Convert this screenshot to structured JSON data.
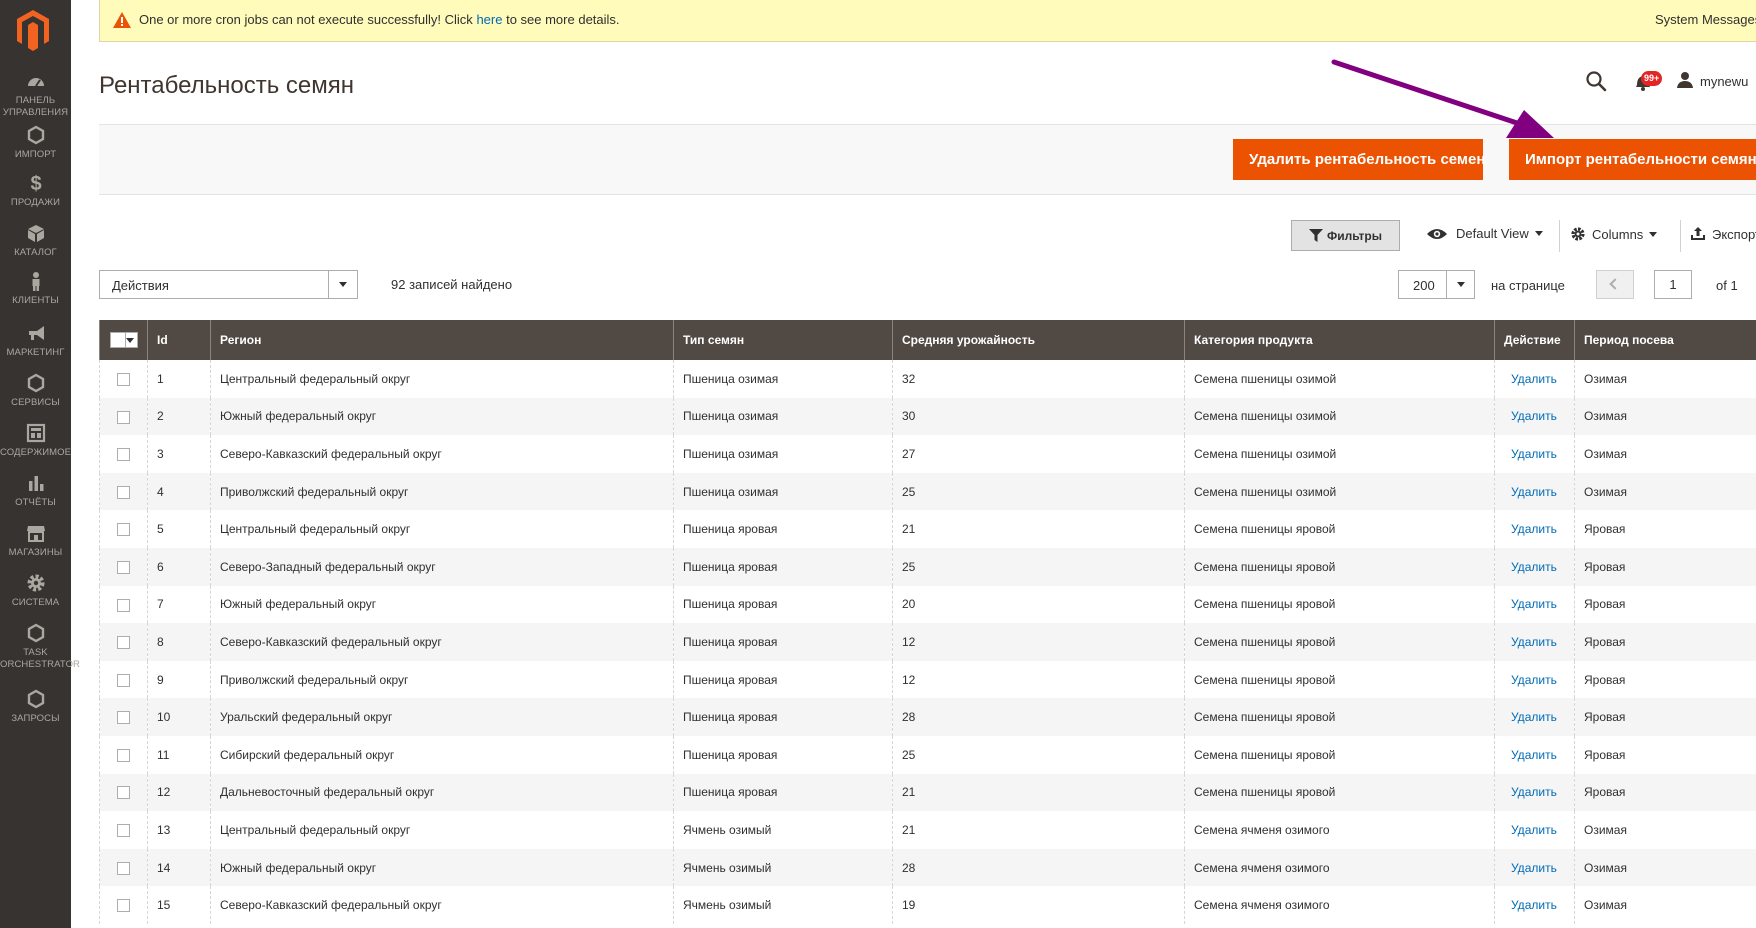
{
  "notice": {
    "text_before": "One or more cron jobs can not execute successfully! Click ",
    "link": "here",
    "text_after": " to see more details.",
    "system_messages": "System Messages"
  },
  "nav": [
    {
      "label": "ПАНЕЛЬ УПРАВЛЕНИЯ",
      "icon": "dashboard-icon"
    },
    {
      "label": "ИМПОРТ",
      "icon": "hexagon-icon"
    },
    {
      "label": "ПРОДАЖИ",
      "icon": "dollar-icon"
    },
    {
      "label": "КАТАЛОГ",
      "icon": "cube-icon"
    },
    {
      "label": "КЛИЕНТЫ",
      "icon": "person-icon"
    },
    {
      "label": "МАРКЕТИНГ",
      "icon": "megaphone-icon"
    },
    {
      "label": "СЕРВИСЫ",
      "icon": "hexagon-icon"
    },
    {
      "label": "СОДЕРЖИМОЕ",
      "icon": "layout-icon"
    },
    {
      "label": "ОТЧЁТЫ",
      "icon": "bar-chart-icon"
    },
    {
      "label": "МАГАЗИНЫ",
      "icon": "store-icon"
    },
    {
      "label": "СИСТЕМА",
      "icon": "gear-icon"
    },
    {
      "label": "TASK ORCHESTRATOR",
      "icon": "hexagon-icon"
    },
    {
      "label": "ЗАПРОСЫ",
      "icon": "hexagon-icon"
    }
  ],
  "header": {
    "title": "Рентабельность семян",
    "notifications_count": "99+",
    "username": "mynewu"
  },
  "buttons": {
    "delete": "Удалить рентабельность семен",
    "import": "Импорт рентабельности семян"
  },
  "toolbar": {
    "filters": "Фильтры",
    "view": "Default View",
    "columns": "Columns",
    "export": "Экспорт"
  },
  "mass_actions": {
    "label": "Действия",
    "records_found": "92 записей найдено"
  },
  "pager": {
    "per_page": "200",
    "per_page_label": "на странице",
    "current_page": "1",
    "of_pages": "of 1"
  },
  "columns": [
    "Id",
    "Регион",
    "Тип семян",
    "Средняя урожайность",
    "Категория продукта",
    "Действие",
    "Период посева"
  ],
  "rows": [
    {
      "id": "1",
      "region": "Центральный федеральный округ",
      "type": "Пшеница озимая",
      "yield": "32",
      "category": "Семена пшеницы озимой",
      "action": "Удалить",
      "period": "Озимая"
    },
    {
      "id": "2",
      "region": "Южный федеральный округ",
      "type": "Пшеница озимая",
      "yield": "30",
      "category": "Семена пшеницы озимой",
      "action": "Удалить",
      "period": "Озимая"
    },
    {
      "id": "3",
      "region": "Северо-Кавказский федеральный округ",
      "type": "Пшеница озимая",
      "yield": "27",
      "category": "Семена пшеницы озимой",
      "action": "Удалить",
      "period": "Озимая"
    },
    {
      "id": "4",
      "region": "Приволжский федеральный округ",
      "type": "Пшеница озимая",
      "yield": "25",
      "category": "Семена пшеницы озимой",
      "action": "Удалить",
      "period": "Озимая"
    },
    {
      "id": "5",
      "region": "Центральный федеральный округ",
      "type": "Пшеница яровая",
      "yield": "21",
      "category": "Семена пшеницы яровой",
      "action": "Удалить",
      "period": "Яровая"
    },
    {
      "id": "6",
      "region": "Северо-Западный федеральный округ",
      "type": "Пшеница яровая",
      "yield": "25",
      "category": "Семена пшеницы яровой",
      "action": "Удалить",
      "period": "Яровая"
    },
    {
      "id": "7",
      "region": "Южный федеральный округ",
      "type": "Пшеница яровая",
      "yield": "20",
      "category": "Семена пшеницы яровой",
      "action": "Удалить",
      "period": "Яровая"
    },
    {
      "id": "8",
      "region": "Северо-Кавказский федеральный округ",
      "type": "Пшеница яровая",
      "yield": "12",
      "category": "Семена пшеницы яровой",
      "action": "Удалить",
      "period": "Яровая"
    },
    {
      "id": "9",
      "region": "Приволжский федеральный округ",
      "type": "Пшеница яровая",
      "yield": "12",
      "category": "Семена пшеницы яровой",
      "action": "Удалить",
      "period": "Яровая"
    },
    {
      "id": "10",
      "region": "Уральский федеральный округ",
      "type": "Пшеница яровая",
      "yield": "28",
      "category": "Семена пшеницы яровой",
      "action": "Удалить",
      "period": "Яровая"
    },
    {
      "id": "11",
      "region": "Сибирский федеральный округ",
      "type": "Пшеница яровая",
      "yield": "25",
      "category": "Семена пшеницы яровой",
      "action": "Удалить",
      "period": "Яровая"
    },
    {
      "id": "12",
      "region": "Дальневосточный федеральный округ",
      "type": "Пшеница яровая",
      "yield": "21",
      "category": "Семена пшеницы яровой",
      "action": "Удалить",
      "period": "Яровая"
    },
    {
      "id": "13",
      "region": "Центральный федеральный округ",
      "type": "Ячмень озимый",
      "yield": "21",
      "category": "Семена ячменя озимого",
      "action": "Удалить",
      "period": "Озимая"
    },
    {
      "id": "14",
      "region": "Южный федеральный округ",
      "type": "Ячмень озимый",
      "yield": "28",
      "category": "Семена ячменя озимого",
      "action": "Удалить",
      "period": "Озимая"
    },
    {
      "id": "15",
      "region": "Северо-Кавказский федеральный округ",
      "type": "Ячмень озимый",
      "yield": "19",
      "category": "Семена ячменя озимого",
      "action": "Удалить",
      "period": "Озимая"
    }
  ],
  "colors": {
    "accent": "#eb5202",
    "sidebar": "#373330",
    "grid_header": "#514943",
    "link": "#006bb4",
    "annotation_arrow": "#800080"
  }
}
